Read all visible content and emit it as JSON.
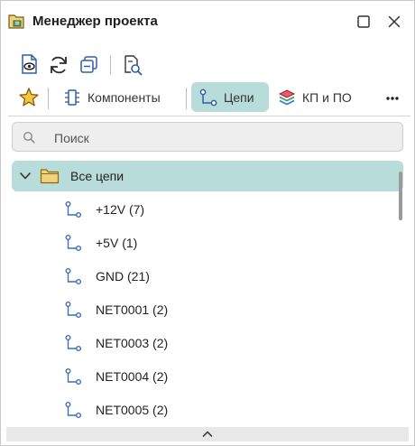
{
  "window": {
    "title": "Менеджер проекта"
  },
  "tabs": [
    {
      "label": "Компоненты",
      "active": false
    },
    {
      "label": "Цепи",
      "active": true
    },
    {
      "label": "КП и ПО",
      "active": false
    }
  ],
  "search": {
    "placeholder": "Поиск",
    "value": ""
  },
  "tree": {
    "root_label": "Все цепи",
    "expanded": true,
    "nets": [
      {
        "label": "+12V (7)"
      },
      {
        "label": "+5V (1)"
      },
      {
        "label": "GND (21)"
      },
      {
        "label": "NET0001 (2)"
      },
      {
        "label": "NET0003 (2)"
      },
      {
        "label": "NET0004 (2)"
      },
      {
        "label": "NET0005 (2)"
      }
    ]
  },
  "colors": {
    "accent_selection": "#b8dcd9",
    "net_icon": "#3d6fb4",
    "folder": "#e0b84f",
    "star": "#e3a21a"
  }
}
